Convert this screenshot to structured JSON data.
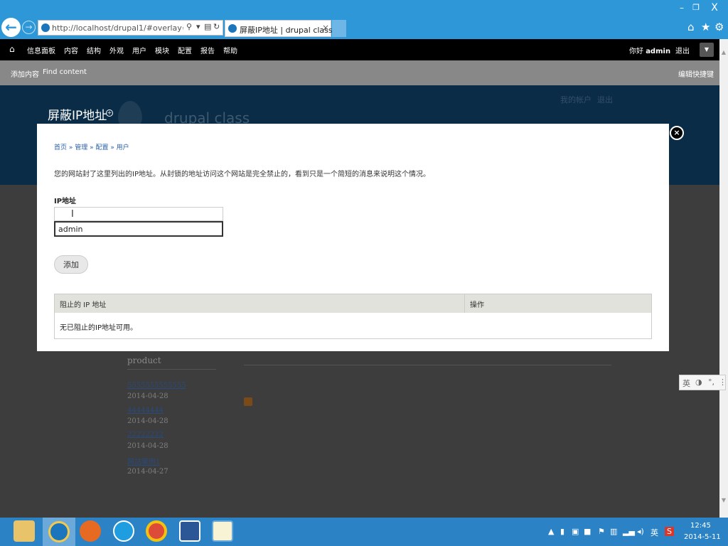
{
  "browser": {
    "url": "http://localhost/drupal1/#overlay=admin/c",
    "tab_title": "屏蔽IP地址 | drupal class",
    "tab_close": "×",
    "window_min": "–",
    "window_max": "❐",
    "window_close": "X"
  },
  "toolbar": {
    "menu": [
      "信息面板",
      "内容",
      "结构",
      "外观",
      "用户",
      "模块",
      "配置",
      "报告",
      "帮助"
    ],
    "greeting": "你好",
    "username": "admin",
    "logout": "退出"
  },
  "shortcuts": {
    "add_content": "添加内容",
    "find_content": "Find content",
    "edit_shortcuts": "编辑快捷键"
  },
  "site": {
    "page_title": "屏蔽IP地址",
    "site_name": "drupal class",
    "my_account": "我的帐户",
    "logout": "退出",
    "sidebar_title": "product",
    "products": [
      {
        "title": "5555555555555",
        "date": "2014-04-28"
      },
      {
        "title": "44444444",
        "date": "2014-04-28"
      },
      {
        "title": "22222222",
        "date": "2014-04-28"
      },
      {
        "title": "网站案例1",
        "date": "2014-04-27"
      }
    ]
  },
  "overlay": {
    "close": "×",
    "breadcrumb": "首页 » 管理 » 配置 » 用户",
    "description": "您的网站封了这里列出的IP地址。从封锁的地址访问这个网站是完全禁止的，看到只是一个简短的消息来说明这个情况。",
    "ip_label": "IP地址",
    "ip_value": "",
    "autocomplete_option": "admin",
    "add_button": "添加",
    "table": {
      "headers": [
        "阻止的 IP 地址",
        "操作"
      ],
      "empty_message": "无已阻止的IP地址可用。"
    }
  },
  "ime_bar": {
    "lang": "英"
  },
  "taskbar": {
    "tray_lang": "英",
    "time": "12:45",
    "date": "2014-5-11"
  },
  "colors": {
    "browser_chrome": "#2e97d8",
    "toolbar": "#000000",
    "shortcut_bar": "#888888",
    "site_header": "#0a2c46",
    "taskbar": "#2b83c6",
    "link": "#2a61a8"
  }
}
